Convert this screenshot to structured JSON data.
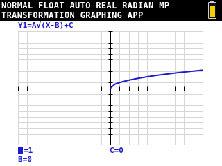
{
  "statusbar": {
    "line1": "NORMAL FLOAT AUTO REAL RADIAN MP",
    "line2": "TRANSFORMATION GRAPHING APP",
    "battery_icon": "battery-icon"
  },
  "equation": {
    "text": "Y1=A√(X-B)+C"
  },
  "params": {
    "a_label": "A",
    "a_value": "=1",
    "b_text": "B=0",
    "c_text": "C=0"
  },
  "colors": {
    "curve": "#1c1cc8",
    "grid": "#d6d6d6",
    "axes": "#000000",
    "battery": "#f0d000"
  },
  "chart_data": {
    "type": "line",
    "title": "",
    "xlabel": "",
    "ylabel": "",
    "xlim": [
      -10,
      10
    ],
    "ylim": [
      -10,
      10
    ],
    "grid": true,
    "series": [
      {
        "x": [
          0,
          0.5,
          1,
          2,
          3,
          4,
          5,
          6,
          7,
          8,
          9,
          10
        ],
        "y": [
          0,
          0.71,
          1,
          1.41,
          1.73,
          2,
          2.24,
          2.45,
          2.65,
          2.83,
          3,
          3.16
        ]
      }
    ]
  }
}
